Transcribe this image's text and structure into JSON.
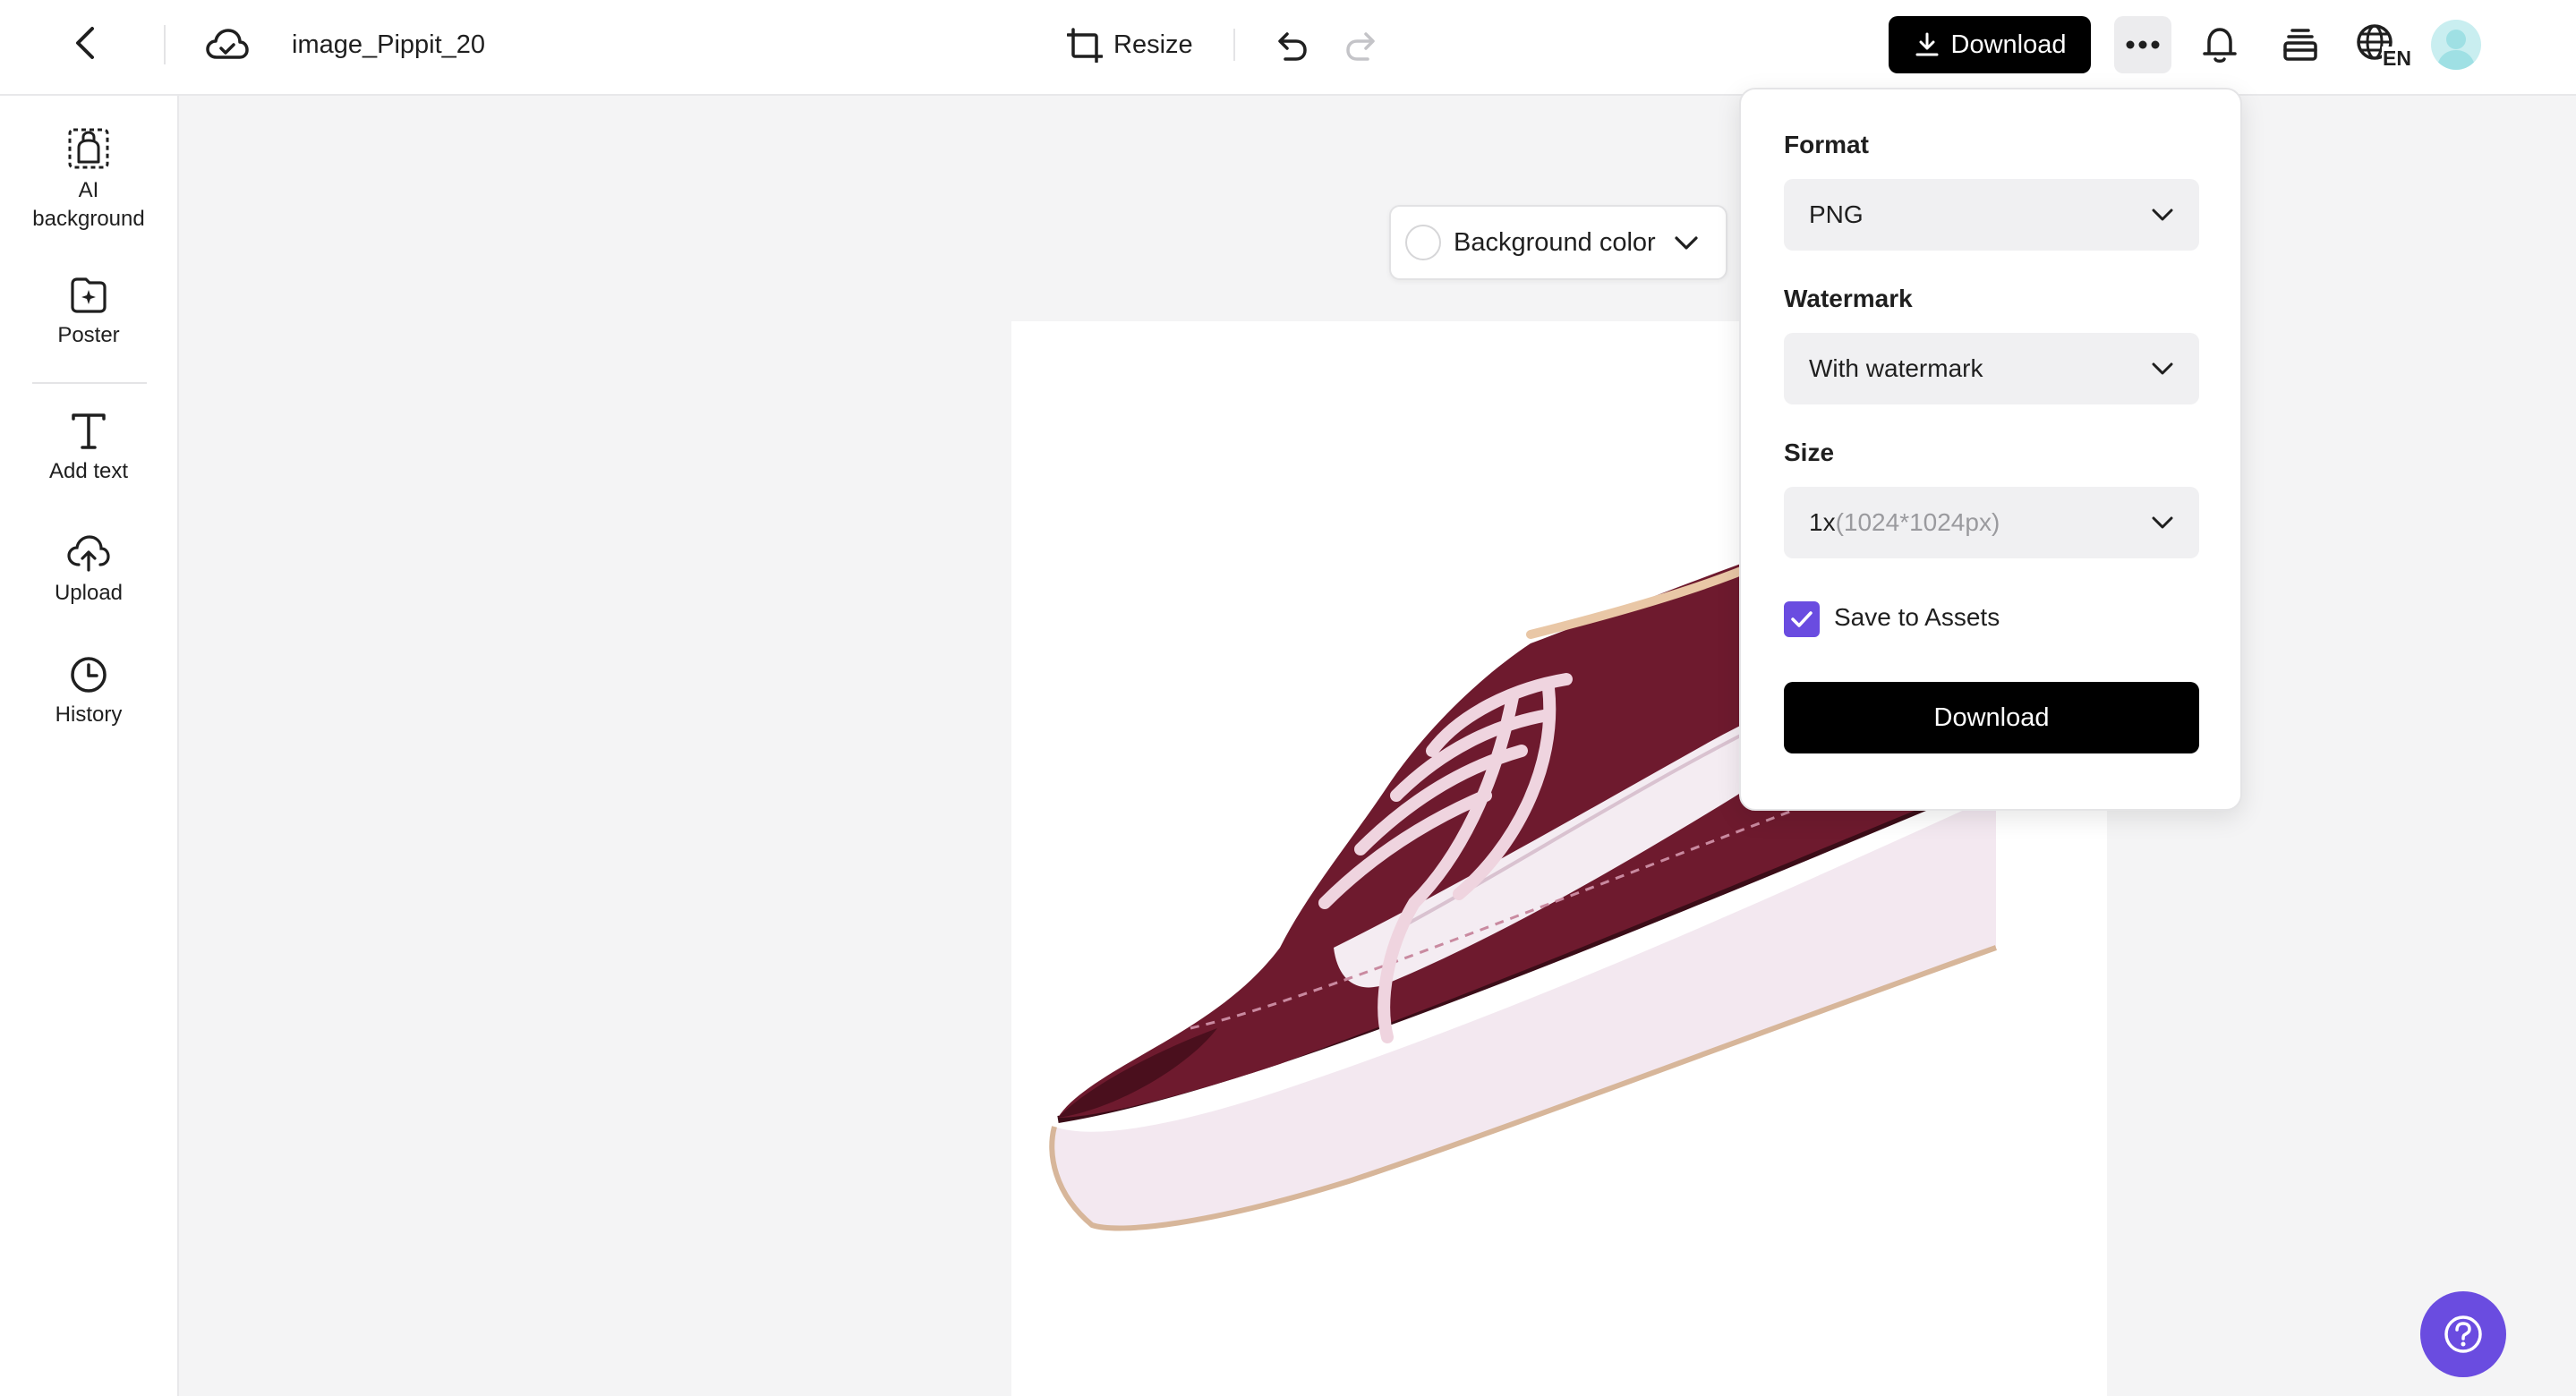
{
  "header": {
    "file_name": "image_Pippit_20",
    "resize_label": "Resize",
    "download_label": "Download",
    "lang_code": "EN"
  },
  "sidebar": {
    "items": [
      {
        "id": "ai-background",
        "label": "AI background",
        "icon": "ai-background-icon"
      },
      {
        "id": "poster",
        "label": "Poster",
        "icon": "poster-icon"
      },
      {
        "id": "add-text",
        "label": "Add text",
        "icon": "text-icon"
      },
      {
        "id": "upload",
        "label": "Upload",
        "icon": "upload-icon"
      },
      {
        "id": "history",
        "label": "History",
        "icon": "history-icon"
      }
    ]
  },
  "canvas": {
    "background_color_label": "Background color"
  },
  "download_panel": {
    "format_label": "Format",
    "format_value": "PNG",
    "watermark_label": "Watermark",
    "watermark_value": "With watermark",
    "size_label": "Size",
    "size_value": "1x",
    "size_detail": "(1024*1024px)",
    "save_to_assets_label": "Save to Assets",
    "save_to_assets_checked": true,
    "download_button_label": "Download"
  },
  "colors": {
    "accent": "#6a4ce0",
    "primary_button": "#000000",
    "canvas_bg": "#f4f4f5",
    "shoe_upper": "#6e1a2e",
    "shoe_sole": "#f3e8f0"
  }
}
